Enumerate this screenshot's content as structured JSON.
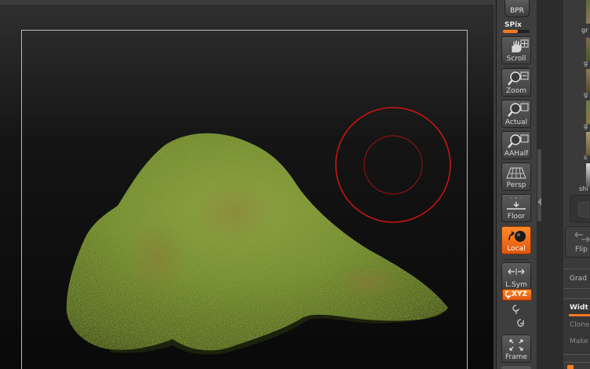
{
  "shelf": {
    "bpr": {
      "label": "BPR"
    },
    "spix": {
      "label": "SPix",
      "level": 0.55
    },
    "buttons": [
      {
        "id": "scroll",
        "label": "Scroll",
        "icon": "hand-scroll-icon",
        "active": false
      },
      {
        "id": "zoom",
        "label": "Zoom",
        "icon": "magnifier-zoom-icon",
        "active": false
      },
      {
        "id": "actual",
        "label": "Actual",
        "icon": "magnifier-actual-icon",
        "active": false
      },
      {
        "id": "aahalf",
        "label": "AAHalf",
        "icon": "magnifier-aahalf-icon",
        "active": false
      },
      {
        "id": "persp",
        "label": "Persp",
        "icon": "perspective-grid-icon",
        "active": false
      },
      {
        "id": "floor",
        "label": "Floor",
        "icon": "floor-grid-icon",
        "active": false
      },
      {
        "id": "local",
        "label": "Local",
        "icon": "local-transform-icon",
        "active": true
      },
      {
        "id": "lsym",
        "label": "L.Sym",
        "icon": "local-symmetry-icon",
        "active": false
      },
      {
        "id": "frame",
        "label": "Frame",
        "icon": "frame-mesh-icon",
        "active": false
      }
    ],
    "xyz": {
      "label": "XYZ",
      "active": true
    }
  },
  "tray": {
    "labels": [
      "gr",
      "g",
      "s",
      "shi",
      "Flip H",
      "Grad",
      "Widt",
      "Clone",
      "Make"
    ]
  },
  "colors": {
    "accent": "#ff7a1e",
    "brush_outer": "#c81414",
    "brush_inner": "#8a1010",
    "mesh_green": "#6f8a2a"
  }
}
